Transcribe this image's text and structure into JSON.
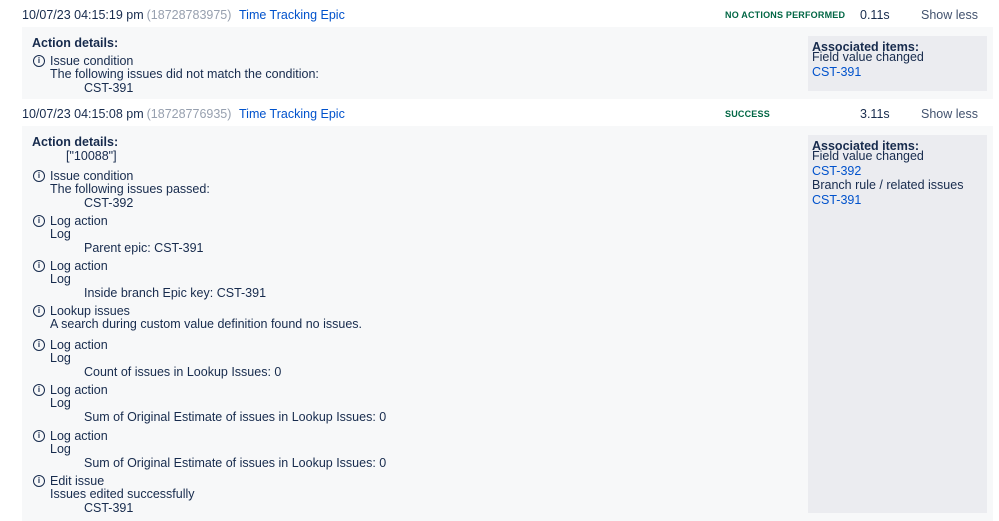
{
  "executions": [
    {
      "timestamp": "10/07/23 04:15:19 pm",
      "id": "(18728783975)",
      "rule": "Time Tracking Epic",
      "status": "NO ACTIONS PERFORMED",
      "status_color": "#006644",
      "duration": "0.11s",
      "toggle": "Show less",
      "details_title": "Action details:",
      "entries": [
        {
          "icon": "info-icon",
          "heading": "Issue condition",
          "subtext": "The following issues did not match the condition:",
          "detail": "CST-391"
        }
      ],
      "associated": {
        "title": "Associated items:",
        "groups": [
          {
            "label": "Field value changed",
            "links": [
              "CST-391"
            ]
          }
        ]
      }
    },
    {
      "timestamp": "10/07/23 04:15:08 pm",
      "id": "(18728776935)",
      "rule": "Time Tracking Epic",
      "status": "SUCCESS",
      "status_color": "#006644",
      "duration": "3.11s",
      "toggle": "Show less",
      "details_title": "Action details:",
      "payload": "[\"10088\"]",
      "entries": [
        {
          "icon": "info-icon",
          "heading": "Issue condition",
          "subtext": "The following issues passed:",
          "detail": "CST-392"
        },
        {
          "icon": "info-icon",
          "heading": "Log action",
          "subtext": "Log",
          "detail": "Parent epic: CST-391"
        },
        {
          "icon": "info-icon",
          "heading": "Log action",
          "subtext": "Log",
          "detail": "Inside branch Epic key: CST-391"
        },
        {
          "icon": "info-icon",
          "heading": "Lookup issues",
          "subtext": "A search during custom value definition found no issues.",
          "detail": ""
        },
        {
          "icon": "info-icon",
          "heading": "Log action",
          "subtext": "Log",
          "detail": "Count of issues in Lookup Issues: 0"
        },
        {
          "icon": "info-icon",
          "heading": "Log action",
          "subtext": "Log",
          "detail": "Sum of Original Estimate of issues in Lookup Issues: 0"
        },
        {
          "icon": "info-icon",
          "heading": "Log action",
          "subtext": "Log",
          "detail": "Sum of Original Estimate of issues in Lookup Issues: 0"
        },
        {
          "icon": "info-icon",
          "heading": "Edit issue",
          "subtext": "Issues edited successfully",
          "detail": "CST-391"
        }
      ],
      "associated": {
        "title": "Associated items:",
        "groups": [
          {
            "label": "Field value changed",
            "links": [
              "CST-392"
            ]
          },
          {
            "label": "Branch rule / related issues",
            "links": [
              "CST-391"
            ]
          }
        ]
      }
    }
  ]
}
